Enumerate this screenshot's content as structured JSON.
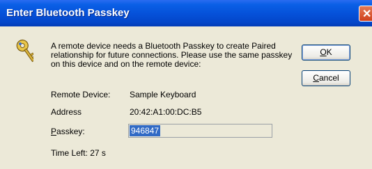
{
  "window": {
    "title": "Enter Bluetooth Passkey"
  },
  "icons": {
    "close": "close-icon",
    "key": "key-icon"
  },
  "message": "A remote device needs a Bluetooth Passkey to create Paired relationship for future connections. Please use the same passkey on this device and on the remote device:",
  "buttons": {
    "ok": {
      "mnemonic": "O",
      "rest": "K"
    },
    "cancel": {
      "mnemonic": "C",
      "rest": "ancel"
    }
  },
  "fields": {
    "remote_device": {
      "label": "Remote Device:",
      "value": "Sample Keyboard"
    },
    "address": {
      "label": "Address",
      "value": "20:42:A1:00:DC:B5"
    },
    "passkey": {
      "label_mnemonic": "P",
      "label_rest": "asskey:",
      "value": "946847"
    }
  },
  "time_left": "Time Left: 27 s",
  "colors": {
    "titlebar": "#0550d8",
    "dialog_bg": "#ece9d8",
    "selection": "#316ac5"
  }
}
